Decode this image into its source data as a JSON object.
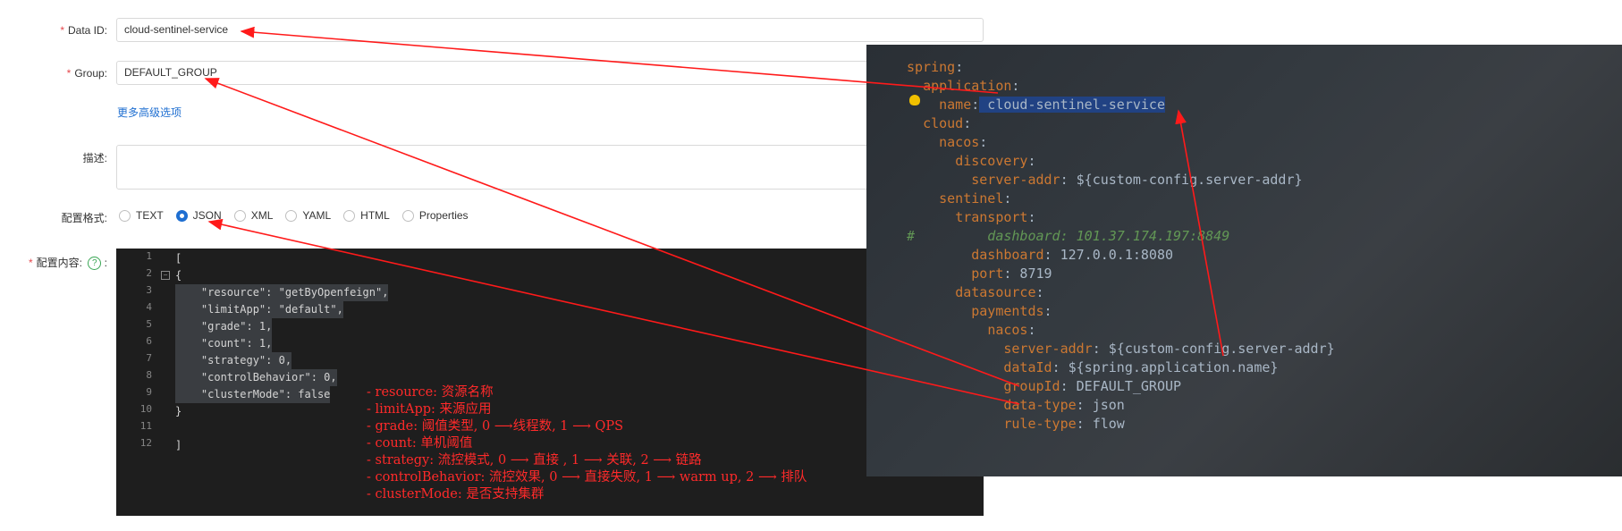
{
  "form": {
    "data_id_label": "Data ID:",
    "data_id_value": "cloud-sentinel-service",
    "group_label": "Group:",
    "group_value": "DEFAULT_GROUP",
    "advanced_link": "更多高级选项",
    "desc_label": "描述:",
    "desc_value": "",
    "format_label": "配置格式:",
    "formats": [
      "TEXT",
      "JSON",
      "XML",
      "YAML",
      "HTML",
      "Properties"
    ],
    "selected_format": "JSON",
    "content_label": "配置内容:",
    "help_icon": "?",
    "colon": ":"
  },
  "editor": {
    "line_numbers": [
      "1",
      "2",
      "3",
      "4",
      "5",
      "6",
      "7",
      "8",
      "9",
      "10",
      "11",
      "12"
    ],
    "lines": [
      "[",
      "{",
      "    \"resource\": \"getByOpenfeign\",",
      "    \"limitApp\": \"default\",",
      "    \"grade\": 1,",
      "    \"count\": 1,",
      "    \"strategy\": 0,",
      "    \"controlBehavior\": 0,",
      "    \"clusterMode\": false",
      "}",
      "",
      "]"
    ]
  },
  "annotations": [
    "- resource: 资源名称",
    "- limitApp: 来源应用",
    "- grade: 阈值类型, 0 ⟶线程数, 1 ⟶ QPS",
    "- count: 单机阈值",
    "- strategy: 流控模式, 0 ⟶ 直接 , 1 ⟶ 关联, 2 ⟶ 链路",
    "- controlBehavior: 流控效果, 0 ⟶ 直接失败, 1 ⟶ warm up, 2 ⟶ 排队",
    "- clusterMode: 是否支持集群"
  ],
  "ide": {
    "lines": [
      "spring:",
      "  application:",
      "    name: cloud-sentinel-service",
      "  cloud:",
      "    nacos:",
      "      discovery:",
      "        server-addr: ${custom-config.server-addr}",
      "    sentinel:",
      "      transport:",
      "#         dashboard: 101.37.174.197:8849",
      "        dashboard: 127.0.0.1:8080",
      "        port: 8719",
      "      datasource:",
      "        paymentds:",
      "          nacos:",
      "            server-addr: ${custom-config.server-addr}",
      "            dataId: ${spring.application.name}",
      "            groupId: DEFAULT_GROUP",
      "            data-type: json",
      "            rule-type: flow"
    ]
  },
  "colors": {
    "arrow": "#ff1a1a",
    "link": "#1f6fd1",
    "checked_radio": "#1f6fd1"
  }
}
